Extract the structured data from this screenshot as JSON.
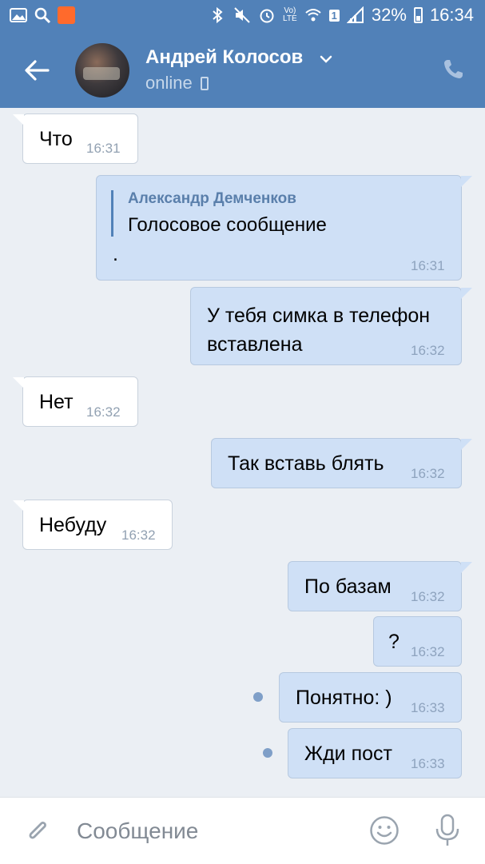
{
  "status_bar": {
    "battery": "32%",
    "time": "16:34",
    "network": "LTE",
    "sim_slot": "1",
    "icons": [
      "gallery-icon",
      "search-icon",
      "app-icon",
      "bluetooth-icon",
      "mute-icon",
      "alarm-icon",
      "volte-icon",
      "wifi-icon",
      "signal-icon",
      "battery-icon"
    ]
  },
  "header": {
    "contact_name": "Андрей Колосов",
    "status": "online",
    "icons": [
      "back-arrow-icon",
      "chevron-down-icon",
      "mobile-device-icon",
      "phone-icon"
    ],
    "accent_color": "#5181b8"
  },
  "messages": [
    {
      "direction": "in",
      "text": "Что",
      "time": "16:31"
    },
    {
      "direction": "out",
      "reply_author": "Александр Демченков",
      "reply_text": "Голосовое сообщение",
      "text": ".",
      "time": "16:31"
    },
    {
      "direction": "out",
      "text": "У тебя симка в телефон вставлена",
      "line1": "У тебя симка в телефон",
      "line2": "вставлена",
      "time": "16:32"
    },
    {
      "direction": "in",
      "text": "Нет",
      "time": "16:32"
    },
    {
      "direction": "out",
      "text": "Так вставь блять",
      "time": "16:32"
    },
    {
      "direction": "in",
      "text": "Небуду",
      "time": "16:32"
    },
    {
      "direction": "out",
      "text": "По базам",
      "time": "16:32"
    },
    {
      "direction": "out",
      "text": "?",
      "time": "16:32"
    },
    {
      "direction": "out",
      "text": "Понятно: )",
      "time": "16:33",
      "unread": true
    },
    {
      "direction": "out",
      "text": "Жди пост",
      "time": "16:33",
      "unread": true
    }
  ],
  "input": {
    "placeholder": "Сообщение",
    "value": "",
    "icons": [
      "paperclip-icon",
      "emoji-icon",
      "microphone-icon"
    ]
  }
}
